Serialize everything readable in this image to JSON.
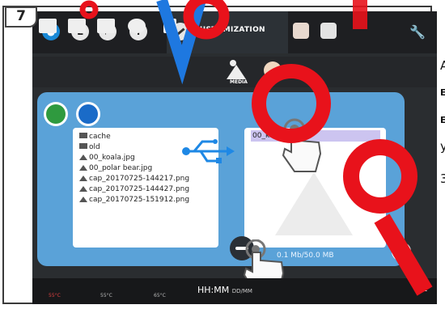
{
  "step": "7",
  "toolbar": {
    "info_label": "i",
    "customization_label": "CUSTOMIZATION"
  },
  "subtoolbar": {
    "media_label": "MEDIA"
  },
  "media": {
    "files": [
      {
        "name": "cache",
        "kind": "folder"
      },
      {
        "name": "old",
        "kind": "folder"
      },
      {
        "name": "00_koala.jpg",
        "kind": "image"
      },
      {
        "name": "00_polar bear.jpg",
        "kind": "image"
      },
      {
        "name": "cap_20170725-144217.png",
        "kind": "image"
      },
      {
        "name": "cap_20170725-144427.png",
        "kind": "image"
      },
      {
        "name": "cap_20170725-151912.png",
        "kind": "image"
      }
    ],
    "selected_file": "00_koala.png",
    "storage_usage": "0.1 Mb/50.0 MB"
  },
  "status": {
    "time": "HH:MM",
    "date": "DD/MM",
    "temp1": "55°C",
    "temp2": "55°C",
    "temp3": "65°C"
  },
  "side_text": {
    "line1": "A",
    "line2": "E",
    "line3": "E",
    "line4": "y",
    "line5": "3"
  },
  "colors": {
    "accent_blue": "#1a89d6",
    "panel_blue": "#5aa2d8",
    "watermark_red": "#e8121b"
  }
}
